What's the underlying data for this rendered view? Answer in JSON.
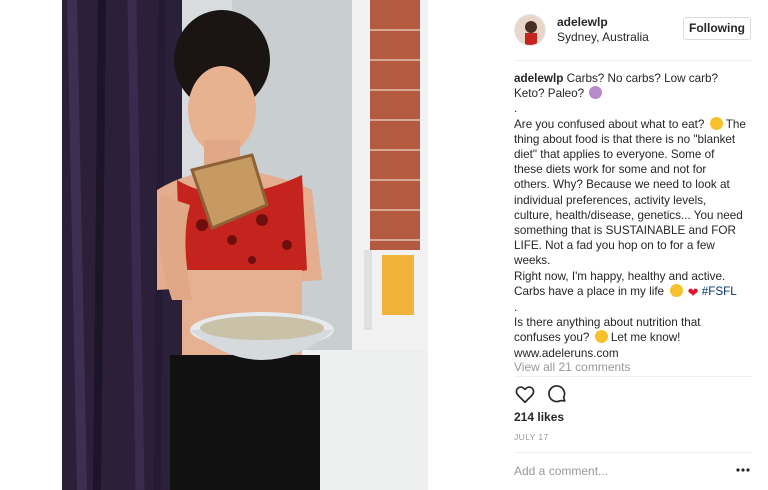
{
  "photo": {
    "icon": "post-photo"
  },
  "header": {
    "username": "adelewlp",
    "location": "Sydney, Australia",
    "follow_label": "Following"
  },
  "caption": {
    "username": "adelewlp",
    "line1": "Carbs? No carbs? Low carb?",
    "line2": "Keto? Paleo?",
    "dot1": ".",
    "para1": [
      "Are you confused about what to eat?",
      "thing about food is that there is no \"blanket",
      "diet\" that applies to everyone. Some of",
      "these diets work for some and not for",
      "others. Why? Because we need to look at",
      "individual preferences, activity levels,",
      "culture, health/disease, genetics... You need",
      "something that is SUSTAINABLE and FOR",
      "LIFE. Not a fad you hop on to for a few",
      "weeks."
    ],
    "para1_after_emoji": "The",
    "line_right_now": "Right now, I'm happy, healthy and active.",
    "line_carbs": "Carbs have a place in my life",
    "hashtag": "#FSFL",
    "dot2": ".",
    "question1": "Is there anything about nutrition that",
    "question2": "confuses you?",
    "question2_after": "Let me know!",
    "website": "www.adeleruns.com"
  },
  "comments": {
    "view_all": "View all 21 comments"
  },
  "actions": {
    "like_icon": "heart-outline-icon",
    "comment_icon": "speech-bubble-icon"
  },
  "likes": "214 likes",
  "date": "JULY 17",
  "comment_box": {
    "placeholder": "Add a comment...",
    "more_icon": "more-options-icon"
  },
  "colors": {
    "text": "#262626",
    "muted": "#999999",
    "hashtag": "#003569",
    "border": "#dbdbdb"
  }
}
